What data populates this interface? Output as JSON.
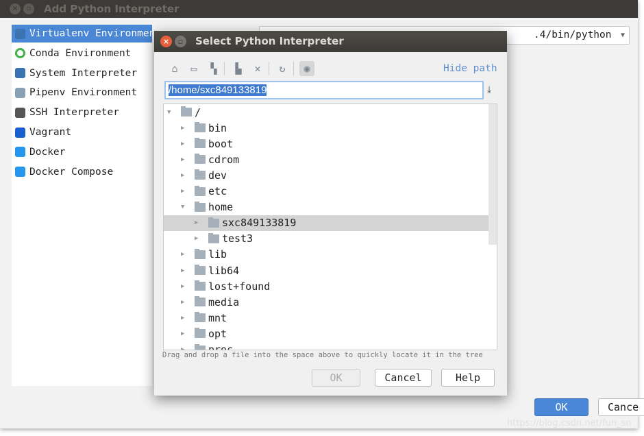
{
  "outer": {
    "title": "Add Python Interpreter",
    "items": [
      {
        "label": "Virtualenv Environment",
        "icon": "python-virtualenv-icon"
      },
      {
        "label": "Conda Environment",
        "icon": "conda-icon"
      },
      {
        "label": "System Interpreter",
        "icon": "python-icon"
      },
      {
        "label": "Pipenv Environment",
        "icon": "pipenv-icon"
      },
      {
        "label": "SSH Interpreter",
        "icon": "ssh-icon"
      },
      {
        "label": "Vagrant",
        "icon": "vagrant-icon"
      },
      {
        "label": "Docker",
        "icon": "docker-icon"
      },
      {
        "label": "Docker Compose",
        "icon": "docker-compose-icon"
      }
    ],
    "interpreter_value": ".4/bin/python",
    "ok": "OK",
    "cancel": "Cance"
  },
  "watermark": "https://blog.csdn.net/fun_sn",
  "dialog": {
    "title": "Select Python Interpreter",
    "hide_path": "Hide path",
    "path": "/home/sxc849133819",
    "tree": [
      {
        "label": "/",
        "depth": 0,
        "expanded": true
      },
      {
        "label": "bin",
        "depth": 1
      },
      {
        "label": "boot",
        "depth": 1
      },
      {
        "label": "cdrom",
        "depth": 1
      },
      {
        "label": "dev",
        "depth": 1
      },
      {
        "label": "etc",
        "depth": 1
      },
      {
        "label": "home",
        "depth": 1,
        "expanded": true
      },
      {
        "label": "sxc849133819",
        "depth": 2,
        "selected": true
      },
      {
        "label": "test3",
        "depth": 2
      },
      {
        "label": "lib",
        "depth": 1
      },
      {
        "label": "lib64",
        "depth": 1
      },
      {
        "label": "lost+found",
        "depth": 1
      },
      {
        "label": "media",
        "depth": 1
      },
      {
        "label": "mnt",
        "depth": 1
      },
      {
        "label": "opt",
        "depth": 1
      },
      {
        "label": "proc",
        "depth": 1
      }
    ],
    "hint": "Drag and drop a file into the space above to quickly locate it in the tree",
    "ok": "OK",
    "cancel": "Cancel",
    "help": "Help"
  },
  "colors": {
    "selection": "#4a88d7",
    "link": "#5f8fd0",
    "close": "#e7603a"
  }
}
